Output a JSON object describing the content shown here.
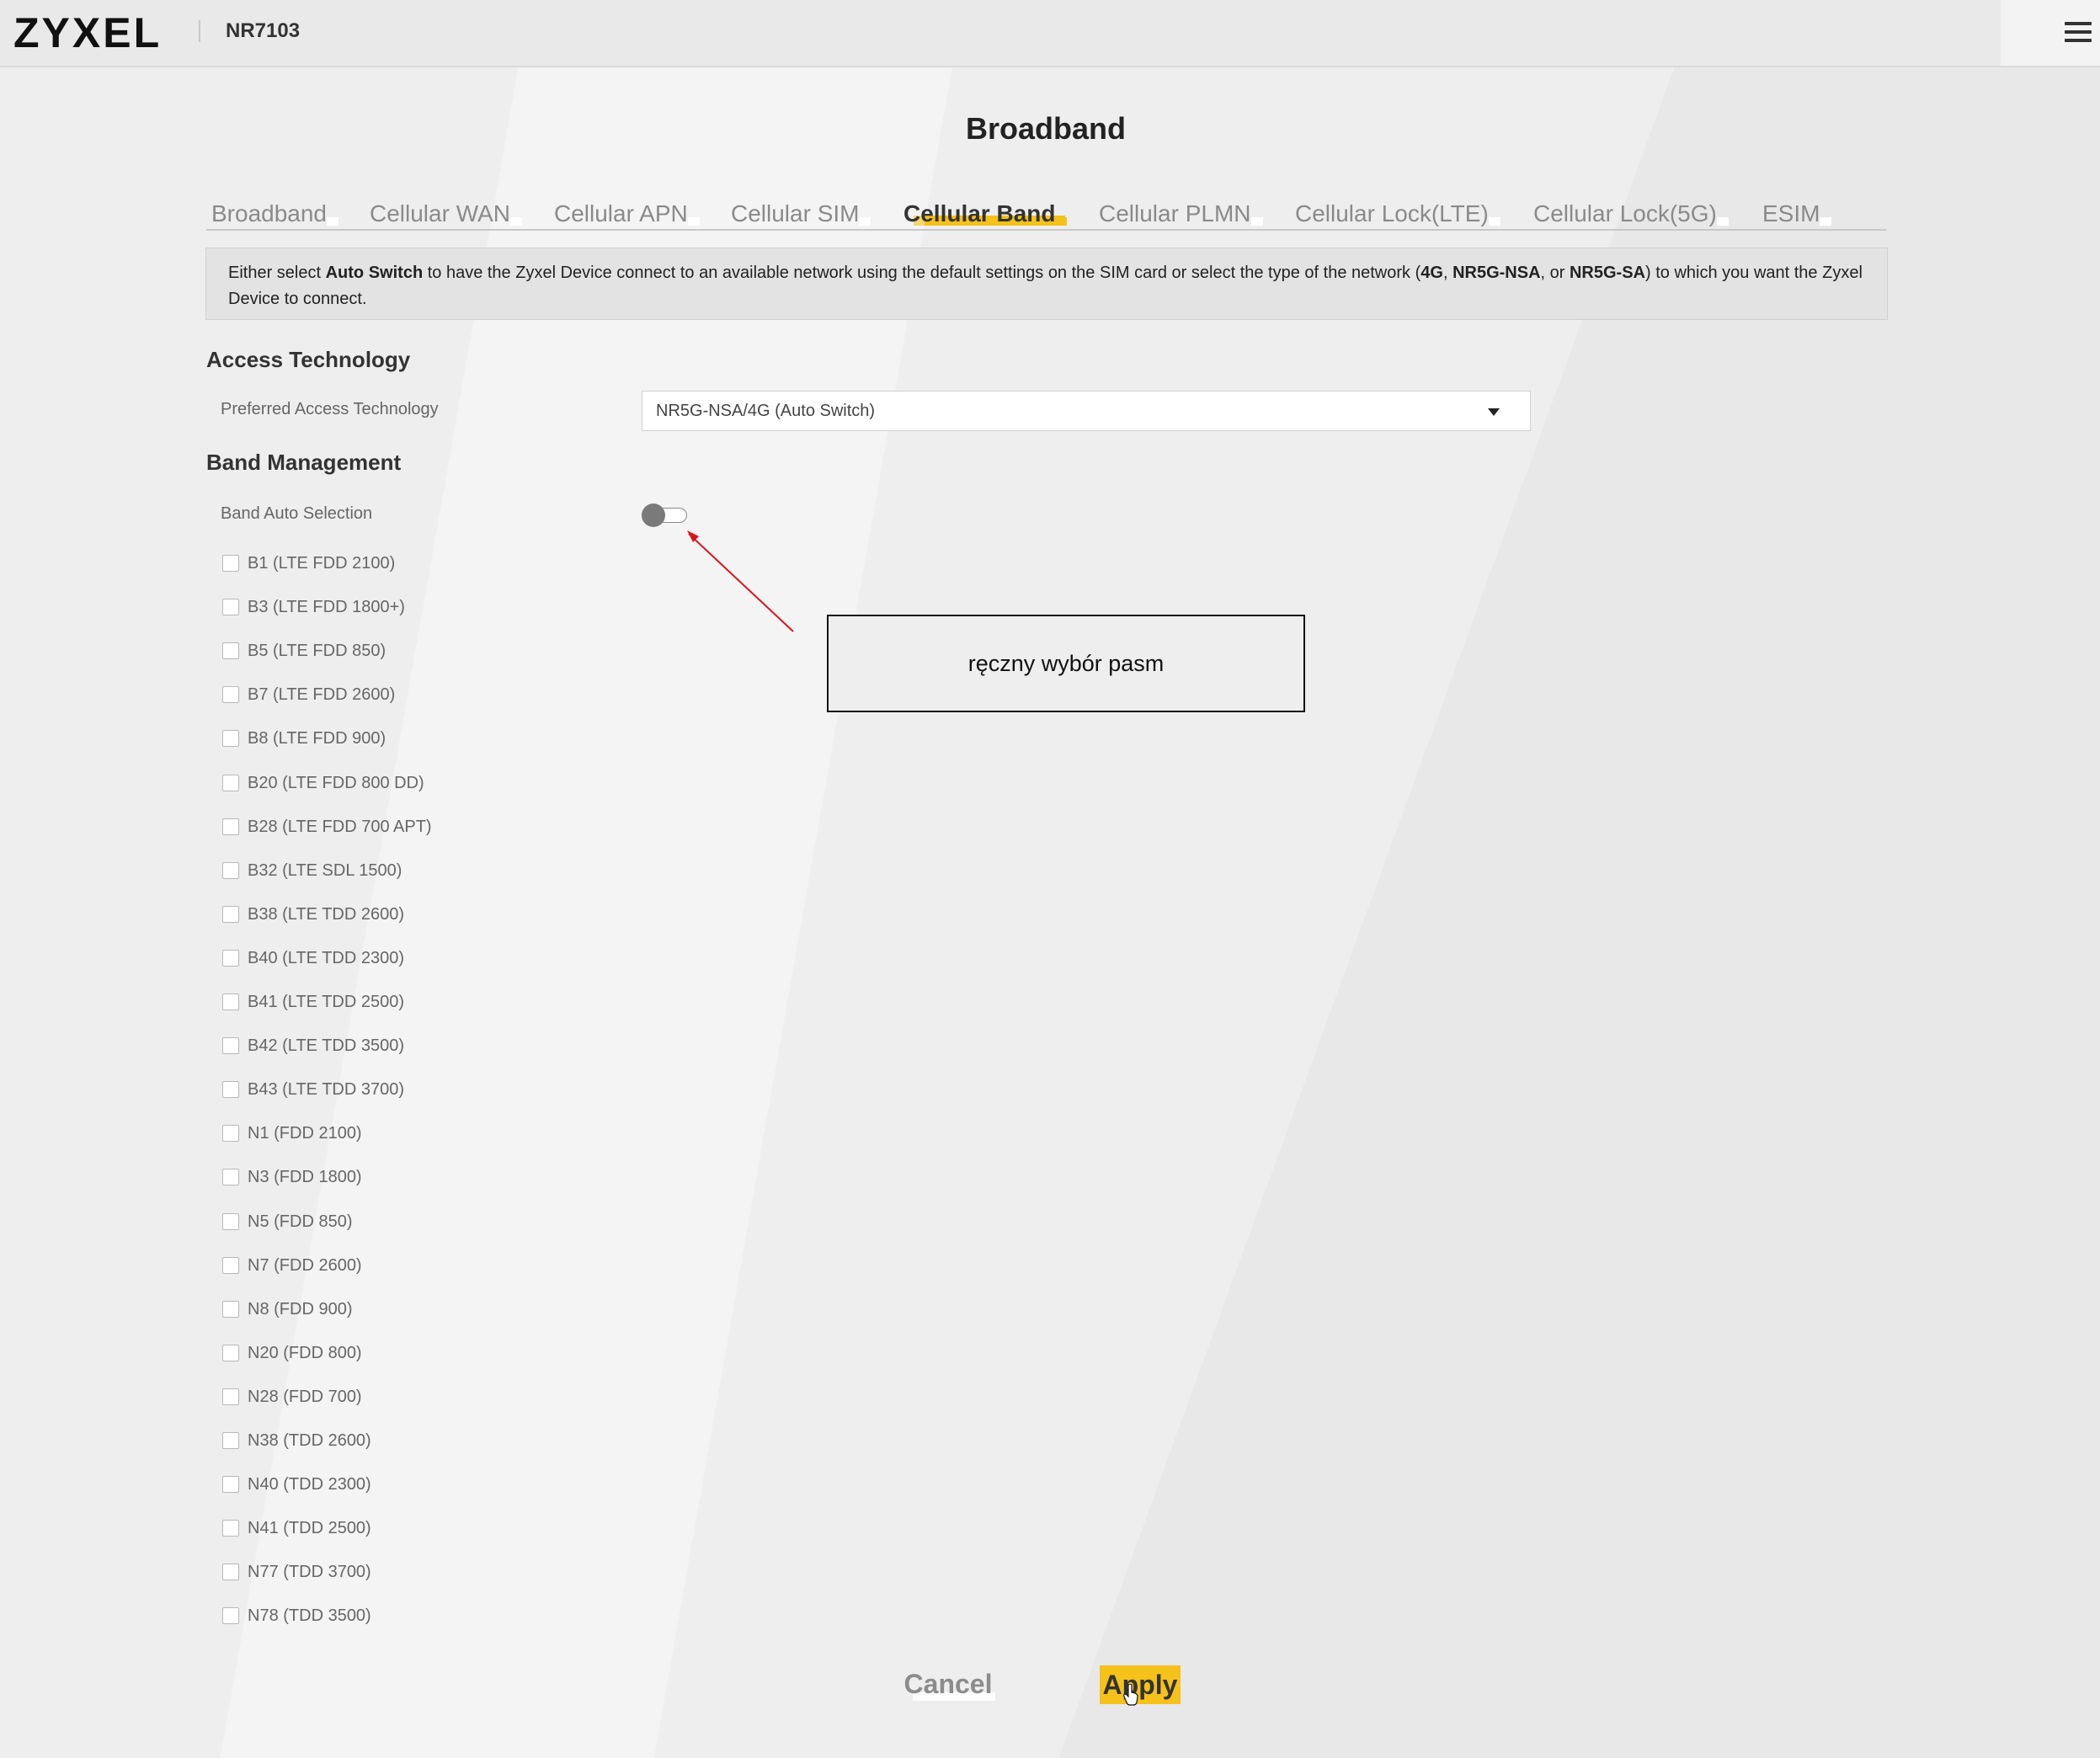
{
  "header": {
    "brand": "ZYXEL",
    "model": "NR7103",
    "menu_icon": "hamburger-menu-icon"
  },
  "page": {
    "title": "Broadband"
  },
  "tabs": [
    {
      "label": "Broadband",
      "active": false
    },
    {
      "label": "Cellular WAN",
      "active": false
    },
    {
      "label": "Cellular APN",
      "active": false
    },
    {
      "label": "Cellular SIM",
      "active": false
    },
    {
      "label": "Cellular Band",
      "active": true
    },
    {
      "label": "Cellular PLMN",
      "active": false
    },
    {
      "label": "Cellular Lock(LTE)",
      "active": false
    },
    {
      "label": "Cellular Lock(5G)",
      "active": false
    },
    {
      "label": "ESIM",
      "active": false
    }
  ],
  "info": {
    "t1": "Either select ",
    "b1": "Auto Switch",
    "t2": " to have the Zyxel Device connect to an available network using the default settings on the SIM card or select the type of the network (",
    "b2": "4G",
    "t3": ", ",
    "b3": "NR5G-NSA",
    "t4": ", or ",
    "b4": "NR5G-SA",
    "t5": ") to which you want the Zyxel Device to connect."
  },
  "access": {
    "title": "Access Technology",
    "preferred_label": "Preferred Access Technology",
    "preferred_value": "NR5G-NSA/4G (Auto Switch)"
  },
  "band_mgmt": {
    "title": "Band Management",
    "auto_label": "Band Auto Selection",
    "auto_enabled": false,
    "bands": [
      {
        "label": "B1 (LTE FDD 2100)",
        "checked": false
      },
      {
        "label": "B3 (LTE FDD 1800+)",
        "checked": false
      },
      {
        "label": "B5 (LTE FDD 850)",
        "checked": false
      },
      {
        "label": "B7 (LTE FDD 2600)",
        "checked": false
      },
      {
        "label": "B8 (LTE FDD 900)",
        "checked": false
      },
      {
        "label": "B20 (LTE FDD 800 DD)",
        "checked": false
      },
      {
        "label": "B28 (LTE FDD 700 APT)",
        "checked": false
      },
      {
        "label": "B32 (LTE SDL 1500)",
        "checked": false
      },
      {
        "label": "B38 (LTE TDD 2600)",
        "checked": false
      },
      {
        "label": "B40 (LTE TDD 2300)",
        "checked": false
      },
      {
        "label": "B41 (LTE TDD 2500)",
        "checked": false
      },
      {
        "label": "B42 (LTE TDD 3500)",
        "checked": false
      },
      {
        "label": "B43 (LTE TDD 3700)",
        "checked": false
      },
      {
        "label": "N1 (FDD 2100)",
        "checked": false
      },
      {
        "label": "N3 (FDD 1800)",
        "checked": false
      },
      {
        "label": "N5 (FDD 850)",
        "checked": false
      },
      {
        "label": "N7 (FDD 2600)",
        "checked": false
      },
      {
        "label": "N8 (FDD 900)",
        "checked": false
      },
      {
        "label": "N20 (FDD 800)",
        "checked": false
      },
      {
        "label": "N28 (FDD 700)",
        "checked": false
      },
      {
        "label": "N38 (TDD 2600)",
        "checked": false
      },
      {
        "label": "N40 (TDD 2300)",
        "checked": false
      },
      {
        "label": "N41 (TDD 2500)",
        "checked": false
      },
      {
        "label": "N77 (TDD 3700)",
        "checked": false
      },
      {
        "label": "N78 (TDD 3500)",
        "checked": false
      }
    ]
  },
  "annotation": {
    "text": "ręczny wybór pasm",
    "arrow_color": "#d9141c"
  },
  "actions": {
    "cancel": "Cancel",
    "apply": "Apply"
  },
  "colors": {
    "accent": "#f5c11b",
    "annotation_arrow": "#d9141c"
  }
}
